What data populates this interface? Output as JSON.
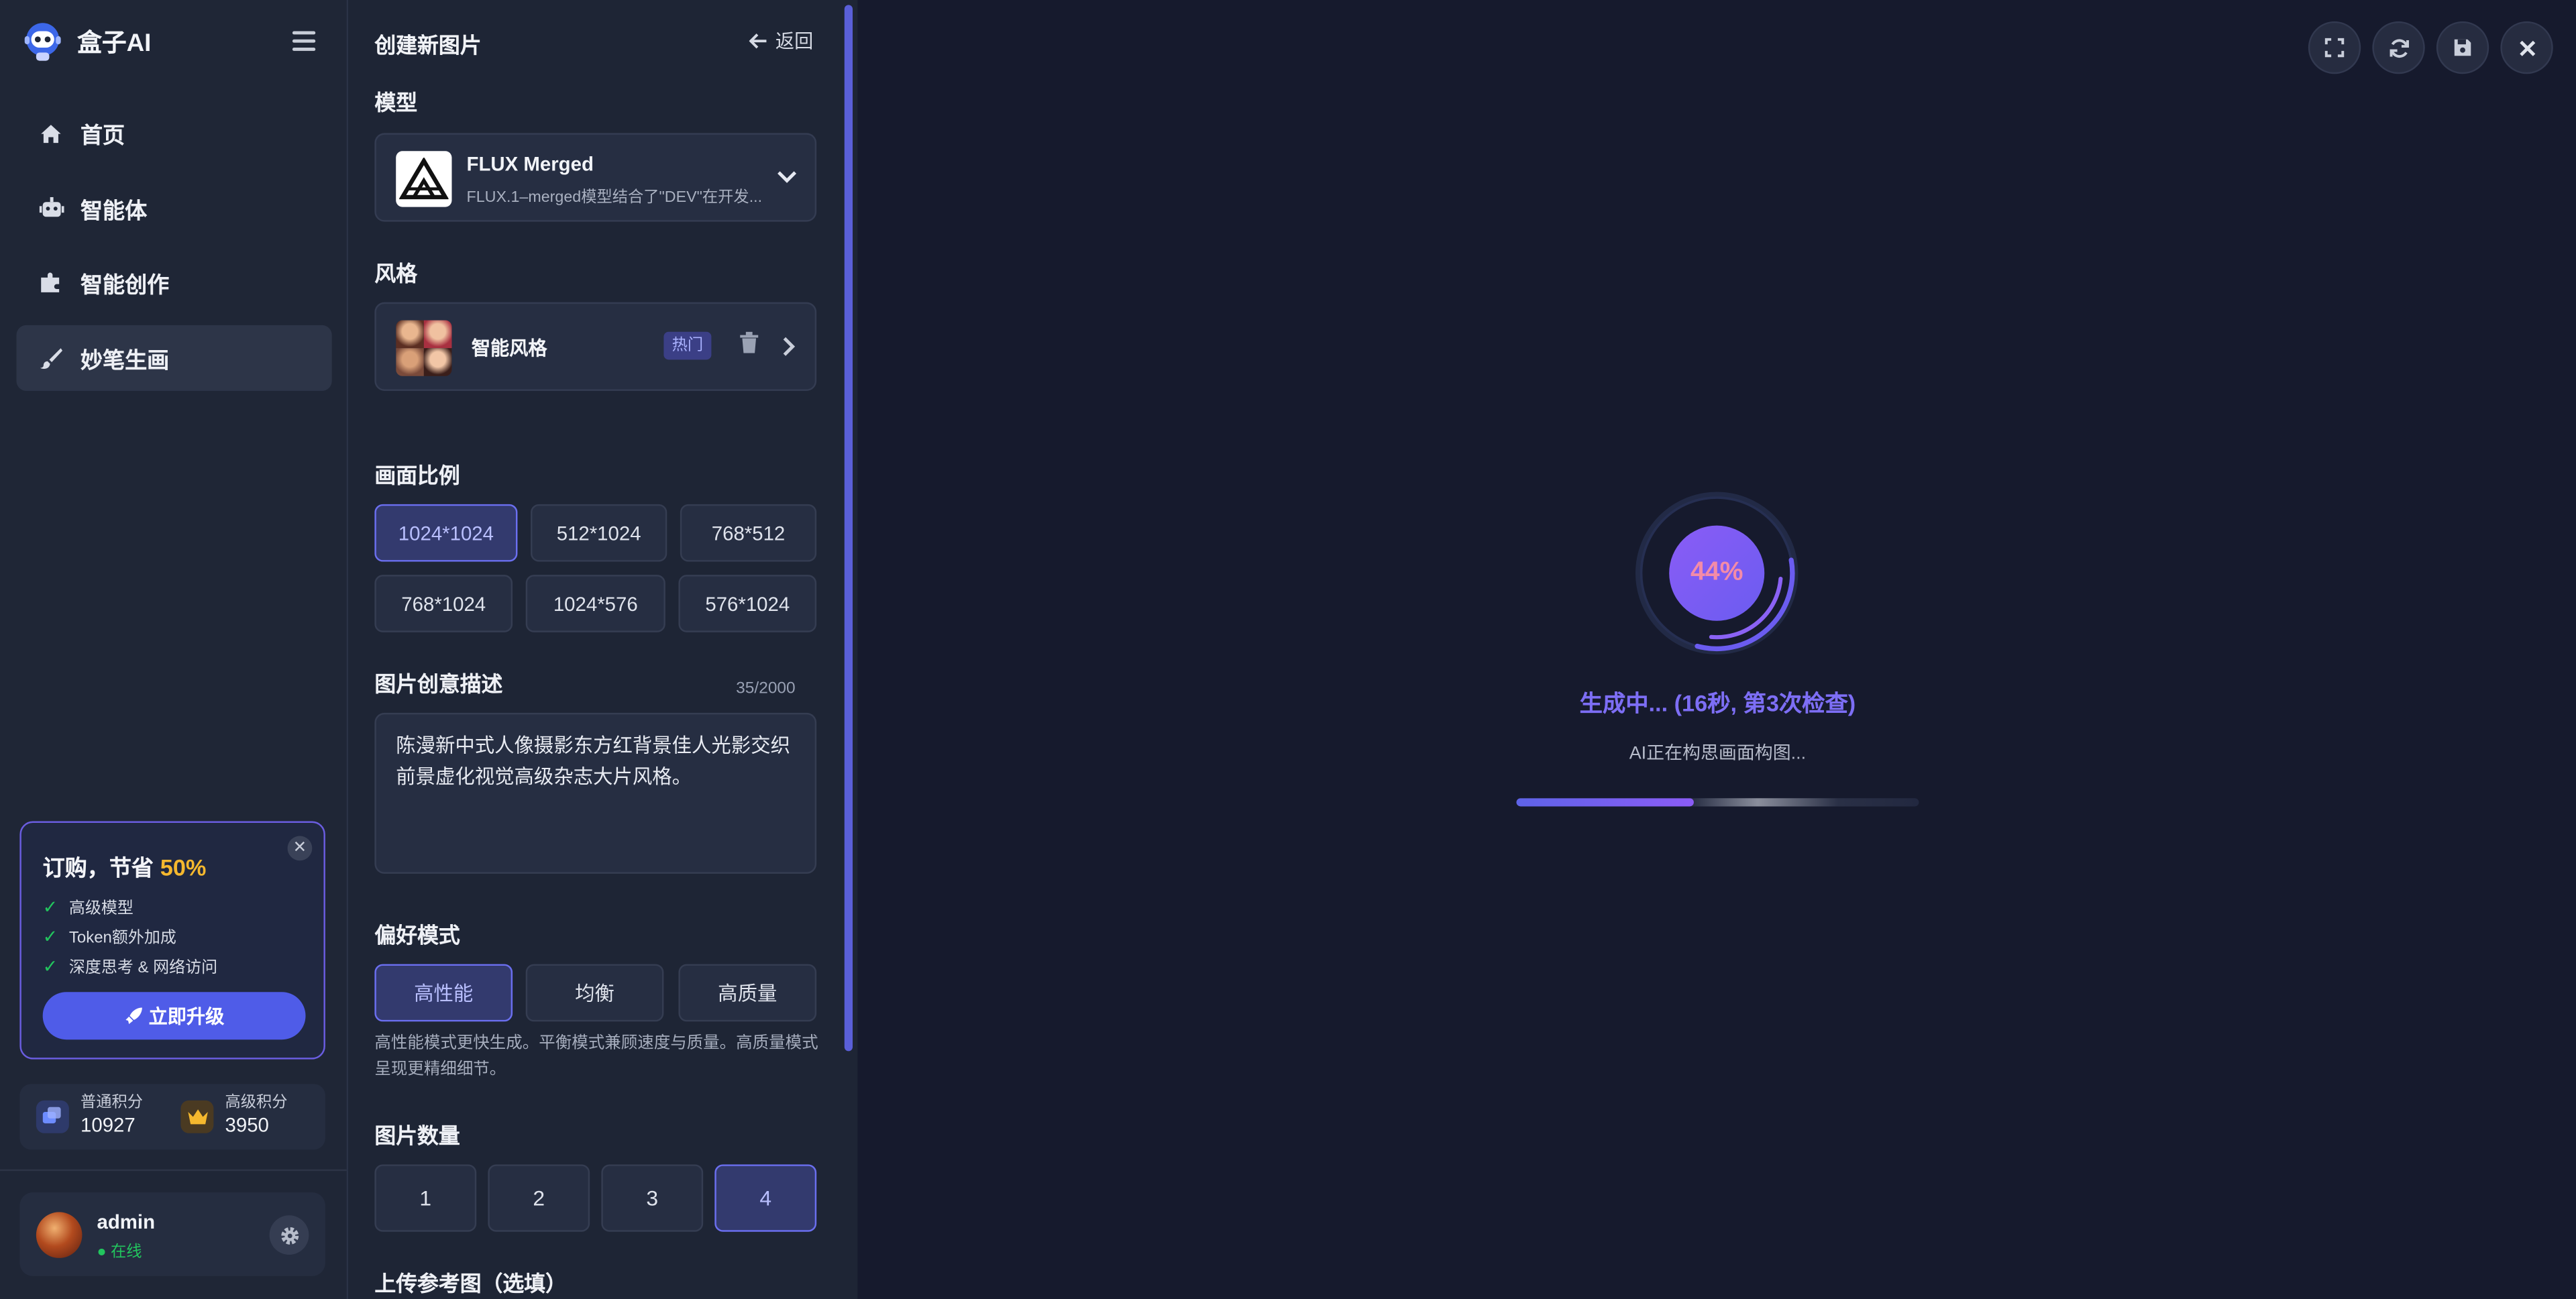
{
  "app": {
    "name": "盒子AI"
  },
  "sidebar": {
    "items": [
      {
        "label": "首页",
        "icon": "home-icon"
      },
      {
        "label": "智能体",
        "icon": "robot-icon"
      },
      {
        "label": "智能创作",
        "icon": "puzzle-icon"
      },
      {
        "label": "妙笔生画",
        "icon": "brush-icon",
        "active": true
      }
    ],
    "promo": {
      "title": "订购，节省",
      "percent": "50%",
      "features": [
        "高级模型",
        "Token额外加成",
        "深度思考 & 网络访问"
      ],
      "button": "立即升级"
    },
    "points": {
      "normal_label": "普通积分",
      "normal_value": "10927",
      "premium_label": "高级积分",
      "premium_value": "3950"
    },
    "user": {
      "name": "admin",
      "status": "● 在线"
    }
  },
  "panel": {
    "title": "创建新图片",
    "back": "返回",
    "model_label": "模型",
    "model": {
      "name": "FLUX Merged",
      "desc": "FLUX.1–merged模型结合了\"DEV\"在开发..."
    },
    "style_label": "风格",
    "style": {
      "name": "智能风格",
      "badge": "热门"
    },
    "ratio_label": "画面比例",
    "ratios": [
      "1024*1024",
      "512*1024",
      "768*512",
      "768*1024",
      "1024*576",
      "576*1024"
    ],
    "ratio_selected": "1024*1024",
    "prompt_label": "图片创意描述",
    "prompt_count": "35/2000",
    "prompt_text": "陈漫新中式人像摄影东方红背景佳人光影交织前景虚化视觉高级杂志大片风格。",
    "pref_label": "偏好模式",
    "prefs": [
      "高性能",
      "均衡",
      "高质量"
    ],
    "pref_selected": "高性能",
    "pref_hint": "高性能模式更快生成。平衡模式兼顾速度与质量。高质量模式呈现更精细细节。",
    "count_label": "图片数量",
    "counts": [
      "1",
      "2",
      "3",
      "4"
    ],
    "count_selected": "4",
    "upload_label": "上传参考图（选填）"
  },
  "main": {
    "toolbar": [
      "fullscreen-icon",
      "refresh-icon",
      "save-icon",
      "close-icon"
    ],
    "progress_percent": 44,
    "progress_text": "44%",
    "status": "生成中... (16秒, 第3次检查)",
    "sub_status": "AI正在构思画面构图...",
    "bar_fraction": 0.44
  },
  "colors": {
    "accent": "#5e63e8",
    "purple": "#7d6ef5",
    "success": "#22c55e",
    "gold": "#f5b82e",
    "pct": "#f38ba8"
  }
}
